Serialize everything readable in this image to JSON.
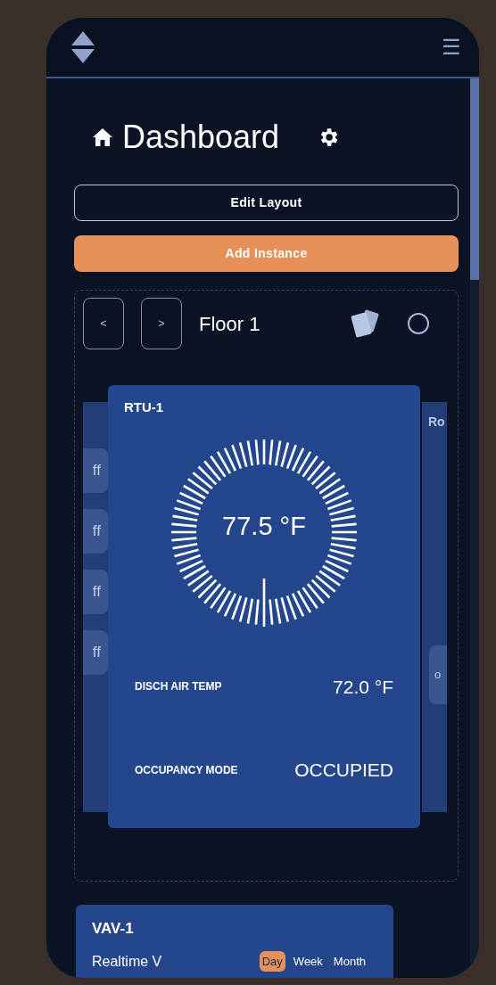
{
  "header": {
    "menu": "☰"
  },
  "page": {
    "title": "Dashboard",
    "buttons": [
      {
        "kind": "outline",
        "label": "Edit Layout"
      },
      {
        "kind": "primary",
        "label": "Add Instance"
      }
    ]
  },
  "carousel": {
    "prev": "<",
    "next": ">",
    "title": "Floor 1",
    "left_card": {
      "chips": [
        "ff",
        "ff",
        "ff",
        "ff"
      ]
    },
    "card": {
      "title": "RTU-1",
      "reading": "77.5 °F",
      "points": [
        {
          "label": "DISCH AIR TEMP",
          "value": "72.0 °F"
        },
        {
          "label": "OCCUPANCY MODE",
          "value": "OCCUPIED"
        }
      ]
    },
    "right_card": {
      "title": "Ro",
      "chip": "o"
    }
  },
  "vav_card": {
    "title": "VAV-1",
    "dropdown": "Realtime",
    "caret": "V",
    "ranges": [
      {
        "label": "Day",
        "selected": true
      },
      {
        "label": "Week",
        "selected": false
      },
      {
        "label": "Month",
        "selected": false
      }
    ]
  }
}
